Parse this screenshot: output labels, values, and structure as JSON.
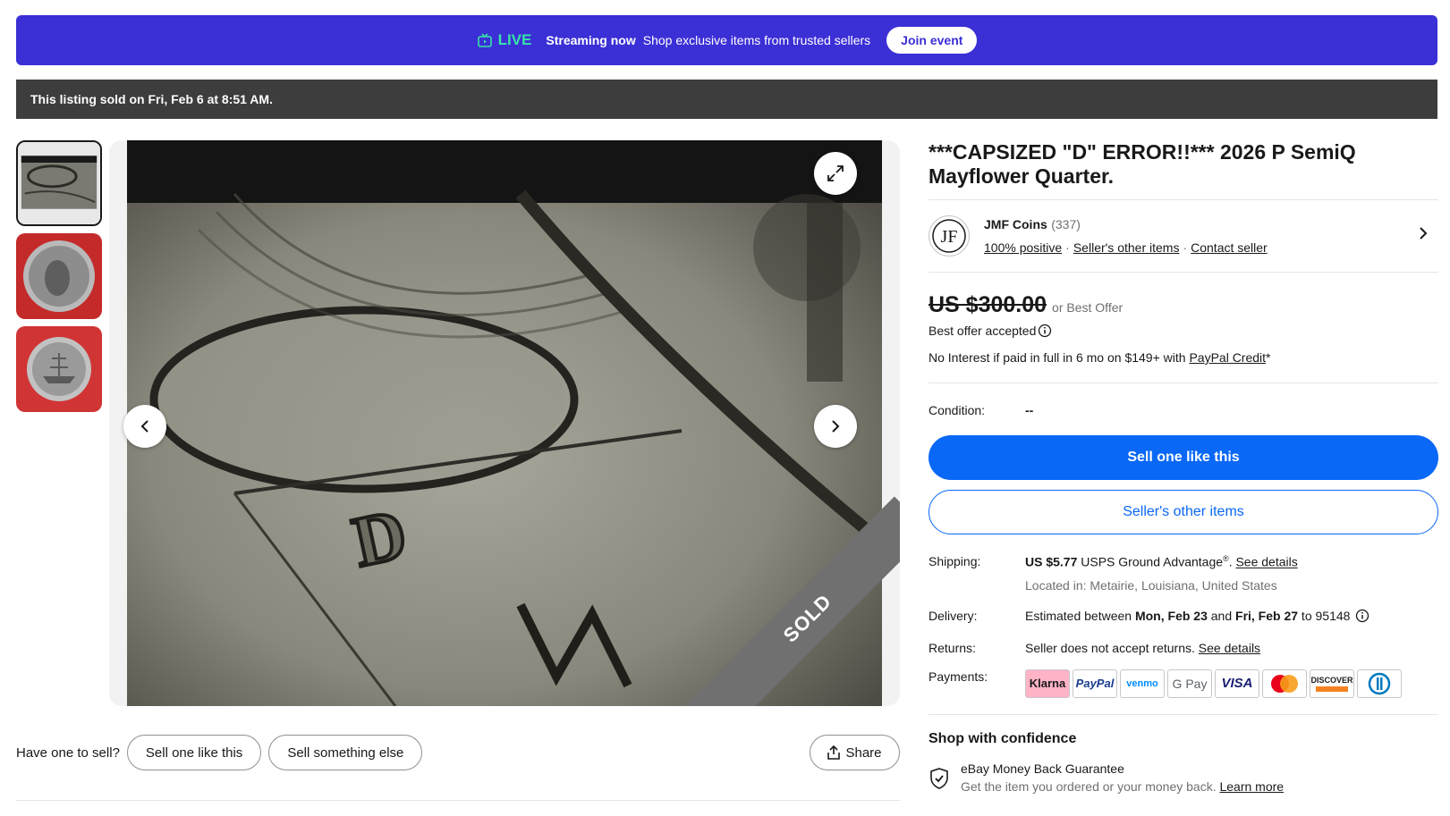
{
  "banner": {
    "live": "LIVE",
    "streaming": "Streaming now",
    "text": "Shop exclusive items from trusted sellers",
    "join": "Join event"
  },
  "sold_notice": "This listing sold on Fri, Feb 6 at 8:51 AM.",
  "gallery": {
    "thumbnails": [
      "thumb-closeup",
      "thumb-coin-obverse",
      "thumb-coin-reverse"
    ],
    "sold_ribbon": "SOLD"
  },
  "sell_row": {
    "question": "Have one to sell?",
    "sell_like": "Sell one like this",
    "sell_else": "Sell something else",
    "share": "Share"
  },
  "listing": {
    "title": "***CAPSIZED \"D\" ERROR!!*** 2026 P SemiQ Mayflower Quarter."
  },
  "seller": {
    "initials": "JF",
    "name": "JMF Coins",
    "count": "(337)",
    "positive": "100% positive",
    "other_items": "Seller's other items",
    "contact": "Contact seller"
  },
  "price": {
    "amount": "US $300.00",
    "best_offer": "or Best Offer",
    "best_offer_accepted": "Best offer accepted",
    "financing_prefix": "No Interest if paid in full in 6 mo on $149+ with ",
    "financing_link": "PayPal Credit",
    "financing_suffix": "*"
  },
  "condition": {
    "label": "Condition:",
    "value": "--"
  },
  "buttons": {
    "primary": "Sell one like this",
    "secondary": "Seller's other items"
  },
  "shipping": {
    "label": "Shipping:",
    "price": "US $5.77",
    "service": "USPS Ground Advantage",
    "sup": "®",
    "see_details": "See details",
    "location": "Located in: Metairie, Louisiana, United States"
  },
  "delivery": {
    "label": "Delivery:",
    "prefix": "Estimated between ",
    "start": "Mon, Feb 23",
    "and": " and ",
    "end": "Fri, Feb 27",
    "suffix": " to 95148"
  },
  "returns": {
    "label": "Returns:",
    "text": "Seller does not accept returns. ",
    "see_details": "See details"
  },
  "payments": {
    "label": "Payments:",
    "methods": [
      "Klarna",
      "PayPal",
      "venmo",
      "G Pay",
      "VISA",
      "mastercard",
      "DISCOVER",
      "Diners"
    ]
  },
  "confidence": {
    "title": "Shop with confidence",
    "guarantee_title": "eBay Money Back Guarantee",
    "guarantee_text": "Get the item you ordered or your money back. ",
    "learn_more": "Learn more"
  },
  "colors": {
    "banner_bg": "#3b2fd6",
    "live_green": "#37e3a8",
    "primary_blue": "#0968f6",
    "sold_bar": "#3d3d3d"
  }
}
